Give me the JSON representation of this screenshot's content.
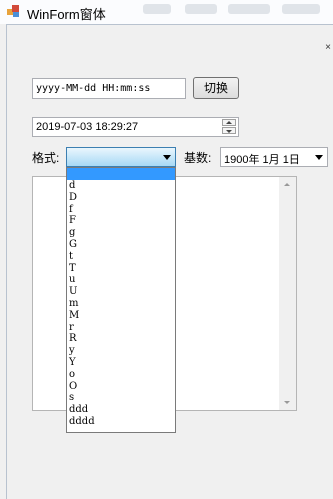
{
  "window": {
    "title": "WinForm窗体"
  },
  "format_input": {
    "value": "yyyy-MM-dd HH:mm:ss"
  },
  "switch_button": {
    "label": "切换"
  },
  "datetime_picker": {
    "value": "2019-07-03 18:29:27"
  },
  "format_label": "格式:",
  "base_label": "基数:",
  "base_combo": {
    "value": "1900年 1月 1日"
  },
  "format_options": [
    "d",
    "D",
    "f",
    "F",
    "g",
    "G",
    "t",
    "T",
    "u",
    "U",
    "m",
    "M",
    "r",
    "R",
    "y",
    "Y",
    "o",
    "O",
    "s",
    "ddd",
    "dddd"
  ],
  "colors": {
    "selection": "#3399ff",
    "combo_border": "#3c7fb1"
  }
}
